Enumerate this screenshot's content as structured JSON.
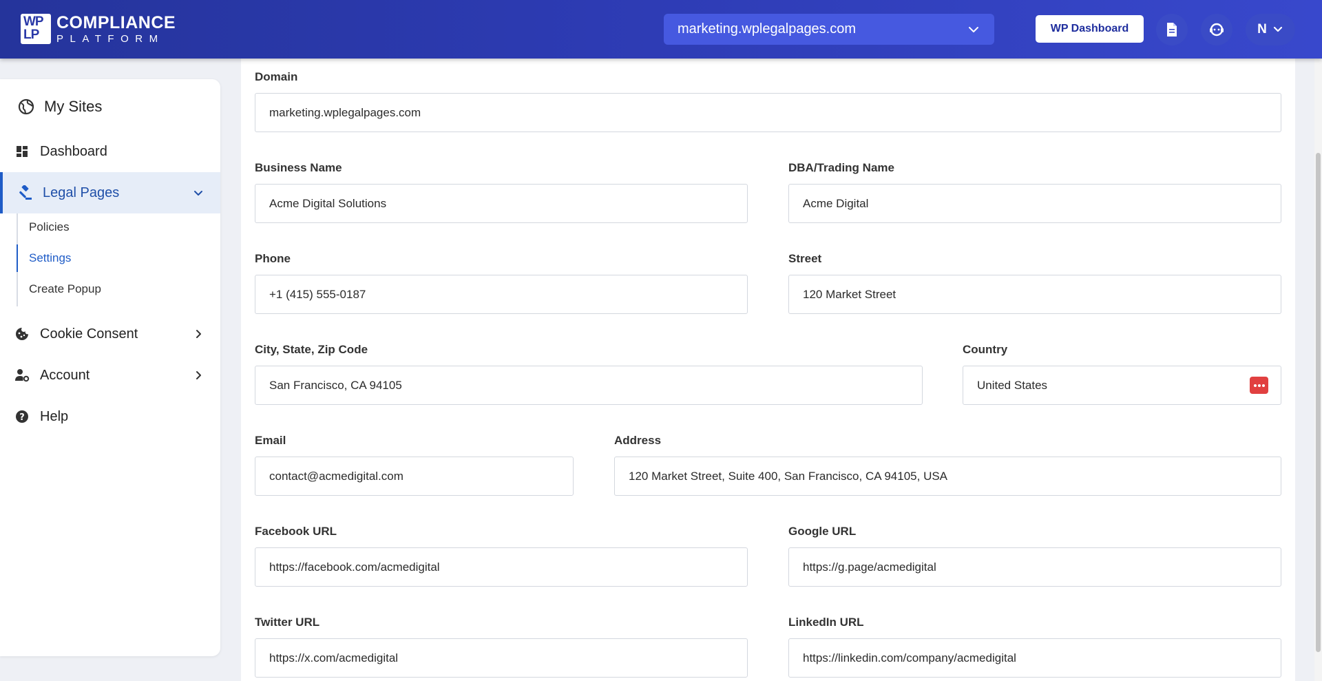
{
  "header": {
    "logo_mark_top": "WP",
    "logo_mark_bottom": "LP",
    "logo_line1": "COMPLIANCE",
    "logo_line2": "PLATFORM",
    "site_selector": "marketing.wplegalpages.com",
    "wp_dashboard_label": "WP Dashboard",
    "user_initial": "N"
  },
  "sidebar": {
    "my_sites": "My Sites",
    "dashboard": "Dashboard",
    "legal_pages": "Legal Pages",
    "sub_items": [
      "Policies",
      "Settings",
      "Create Popup"
    ],
    "cookie_consent": "Cookie Consent",
    "account": "Account",
    "help": "Help"
  },
  "form": {
    "domain": {
      "label": "Domain",
      "value": "marketing.wplegalpages.com"
    },
    "business_name": {
      "label": "Business Name",
      "value": "Acme Digital Solutions"
    },
    "dba": {
      "label": "DBA/Trading Name",
      "value": "Acme Digital"
    },
    "phone": {
      "label": "Phone",
      "value": "+1 (415) 555-0187"
    },
    "street": {
      "label": "Street",
      "value": "120 Market Street"
    },
    "city": {
      "label": "City, State, Zip Code",
      "value": "San Francisco, CA 94105"
    },
    "country": {
      "label": "Country",
      "value": "United States"
    },
    "email": {
      "label": "Email",
      "value": "contact@acmedigital.com"
    },
    "address": {
      "label": "Address",
      "value": "120 Market Street, Suite 400, San Francisco, CA 94105, USA"
    },
    "facebook": {
      "label": "Facebook URL",
      "value": "https://facebook.com/acmedigital"
    },
    "google": {
      "label": "Google URL",
      "value": "https://g.page/acmedigital"
    },
    "twitter": {
      "label": "Twitter URL",
      "value": "https://x.com/acmedigital"
    },
    "linkedin": {
      "label": "LinkedIn URL",
      "value": "https://linkedin.com/company/acmedigital"
    }
  },
  "colors": {
    "header_gradient_start": "#25349b",
    "header_gradient_end": "#3848cc",
    "active_nav": "#1f5cc7",
    "country_badge": "#e14040"
  }
}
